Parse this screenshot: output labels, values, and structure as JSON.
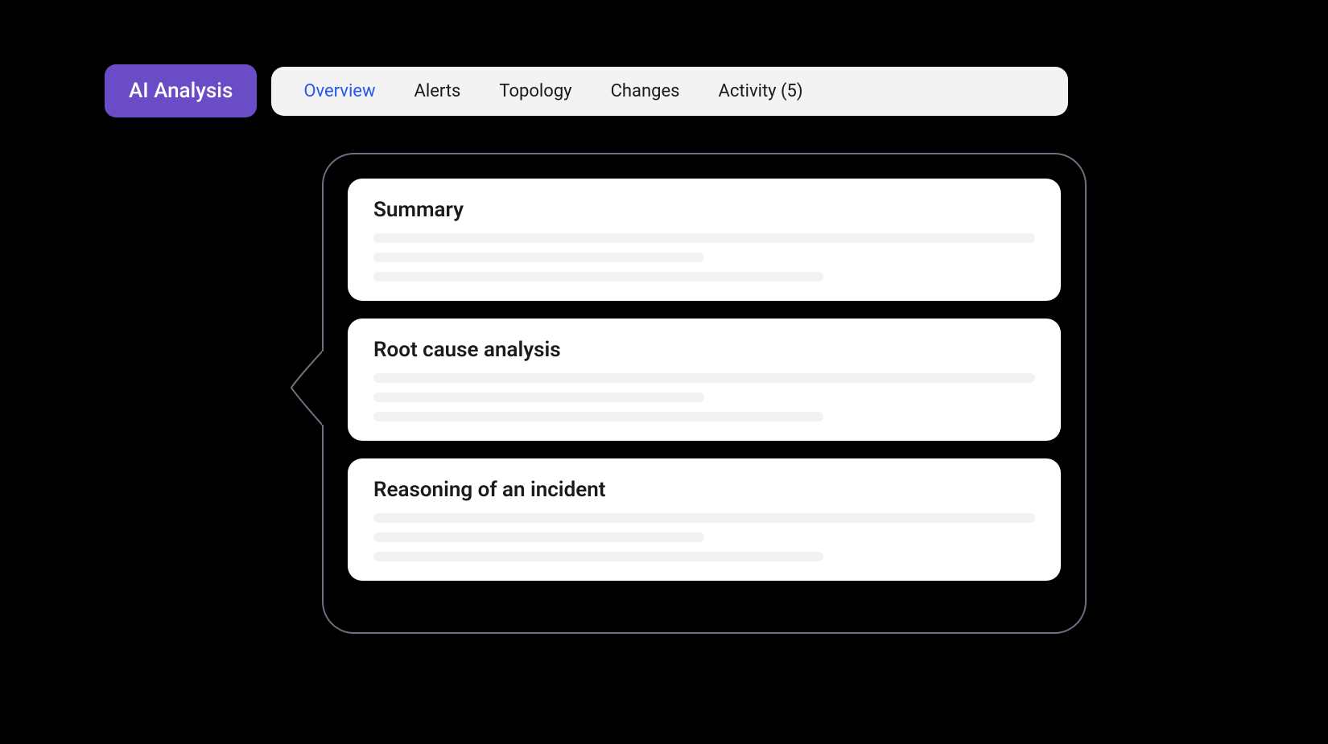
{
  "header": {
    "badge_label": "AI Analysis",
    "tabs": [
      {
        "label": "Overview",
        "active": true
      },
      {
        "label": "Alerts",
        "active": false
      },
      {
        "label": "Topology",
        "active": false
      },
      {
        "label": "Changes",
        "active": false
      },
      {
        "label": "Activity (5)",
        "active": false
      }
    ]
  },
  "panel": {
    "cards": [
      {
        "title": "Summary"
      },
      {
        "title": "Root cause analysis"
      },
      {
        "title": "Reasoning of an incident"
      }
    ]
  }
}
